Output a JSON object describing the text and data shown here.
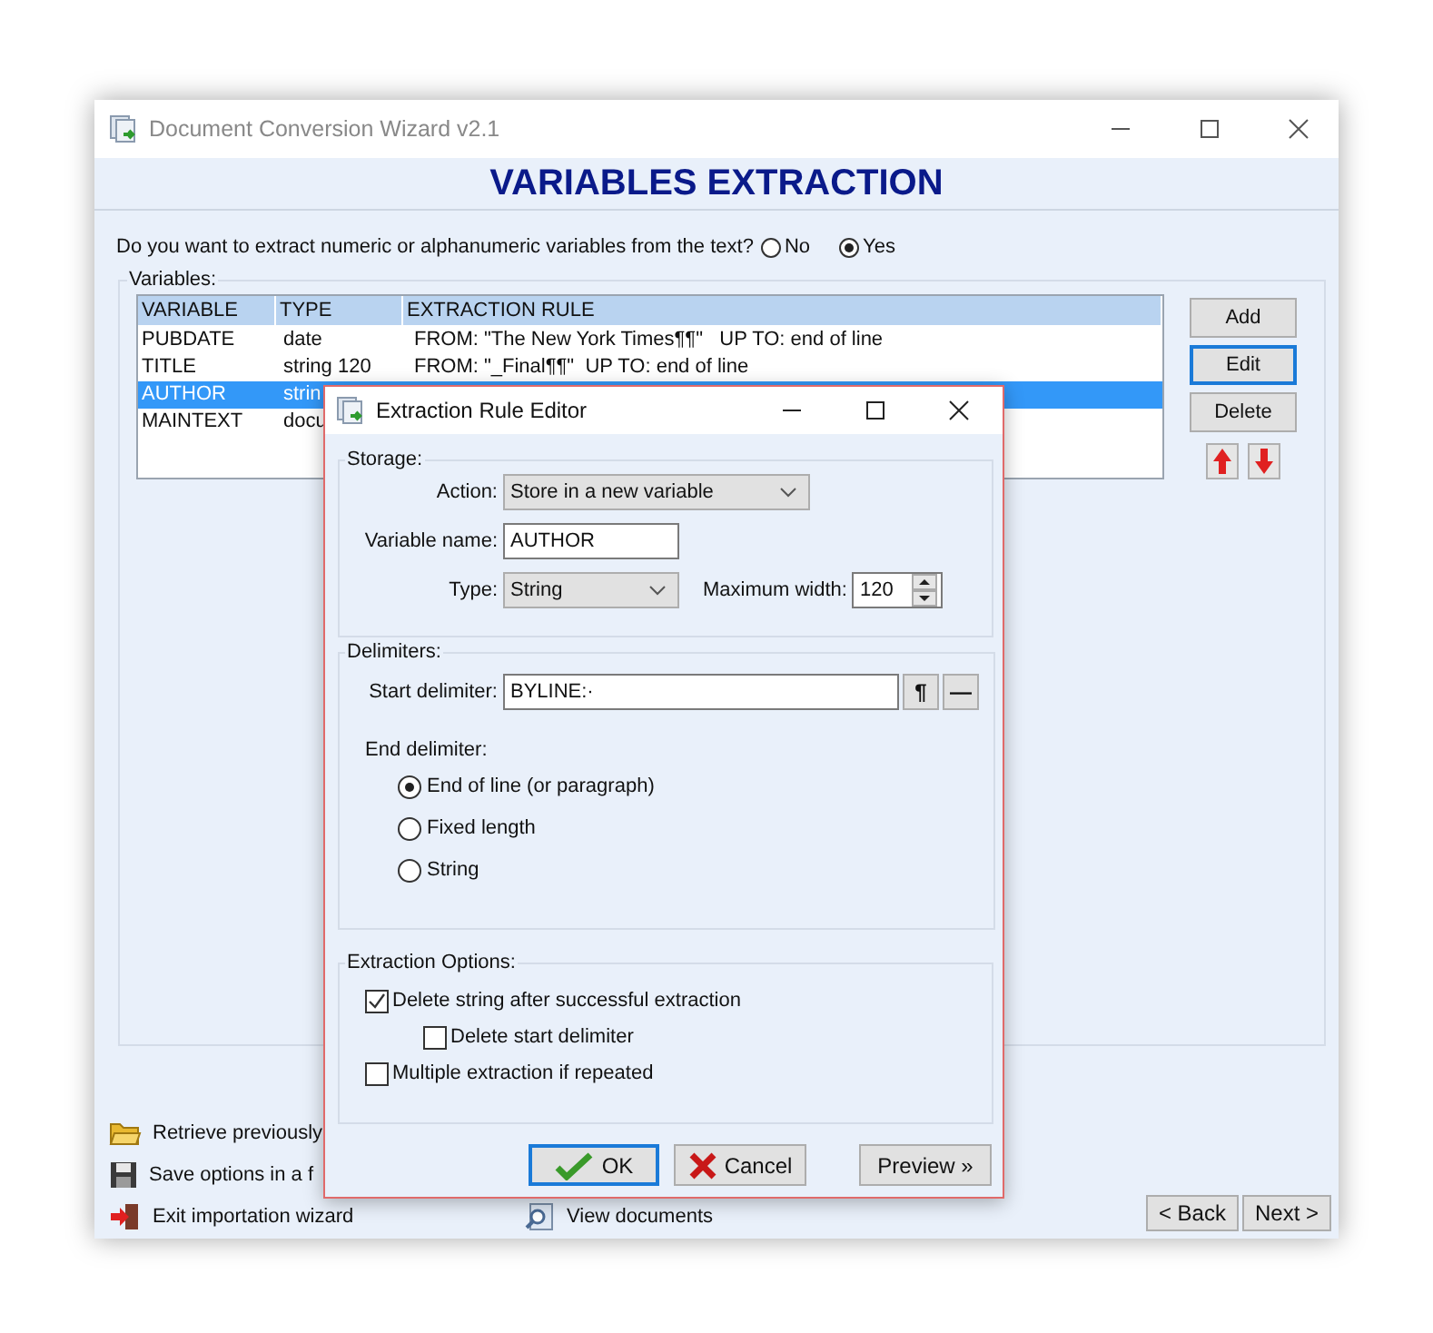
{
  "window": {
    "title": "Document Conversion Wizard v2.1"
  },
  "heading": "VARIABLES EXTRACTION",
  "question": {
    "text": "Do you want to extract numeric or alphanumeric variables from the text?",
    "options": [
      {
        "label": "No",
        "selected": false
      },
      {
        "label": "Yes",
        "selected": true
      }
    ]
  },
  "variables": {
    "label": "Variables:",
    "columns": [
      "VARIABLE",
      "TYPE",
      "EXTRACTION RULE"
    ],
    "rows": [
      {
        "cells": [
          "PUBDATE",
          "date",
          "FROM: \"The New York Times¶¶\"   UP TO: end of line"
        ],
        "selected": false
      },
      {
        "cells": [
          "TITLE",
          "string 120",
          "FROM: \"_Final¶¶\"  UP TO: end of line"
        ],
        "selected": false
      },
      {
        "cells": [
          "AUTHOR",
          "strin"
        ],
        "selected": true
      },
      {
        "cells": [
          "MAINTEXT",
          "docu"
        ],
        "selected": false
      }
    ]
  },
  "side_buttons": [
    {
      "label": "Add",
      "focused": false
    },
    {
      "label": "Edit",
      "focused": true
    },
    {
      "label": "Delete",
      "focused": false
    }
  ],
  "bottom_links": [
    {
      "label": "Retrieve previously",
      "kind": "open"
    },
    {
      "label": "Save options in a f",
      "kind": "save"
    },
    {
      "label": "Exit importation wizard",
      "kind": "exit"
    }
  ],
  "view_link": {
    "label": "View documents"
  },
  "nav_buttons": [
    "< Back",
    "Next >"
  ],
  "dialog": {
    "title": "Extraction Rule Editor",
    "storage": {
      "legend": "Storage:",
      "action_label": "Action:",
      "action_value": "Store in a new variable",
      "name_label": "Variable name:",
      "name_value": "AUTHOR",
      "type_label": "Type:",
      "type_value": "String",
      "width_label": "Maximum width:",
      "width_value": "120"
    },
    "delimiters": {
      "legend": "Delimiters:",
      "start_label": "Start delimiter:",
      "start_value": "BYLINE:·",
      "buttons": [
        "¶",
        "—"
      ],
      "end_label": "End delimiter:",
      "end_options": [
        {
          "label": "End of line (or paragraph)",
          "selected": true
        },
        {
          "label": "Fixed length",
          "selected": false
        },
        {
          "label": "String",
          "selected": false
        }
      ]
    },
    "options": {
      "legend": "Extraction Options:",
      "items": [
        {
          "label": "Delete string after successful extraction",
          "checked": true,
          "children": [
            {
              "label": "Delete start delimiter",
              "checked": false
            }
          ]
        },
        {
          "label": "Multiple extraction if repeated",
          "checked": false
        }
      ]
    },
    "buttons": [
      {
        "label": "OK",
        "kind": "ok",
        "focused": true
      },
      {
        "label": "Cancel",
        "kind": "cancel",
        "focused": false
      },
      {
        "label": "Preview »",
        "kind": "plain",
        "focused": false
      }
    ]
  }
}
